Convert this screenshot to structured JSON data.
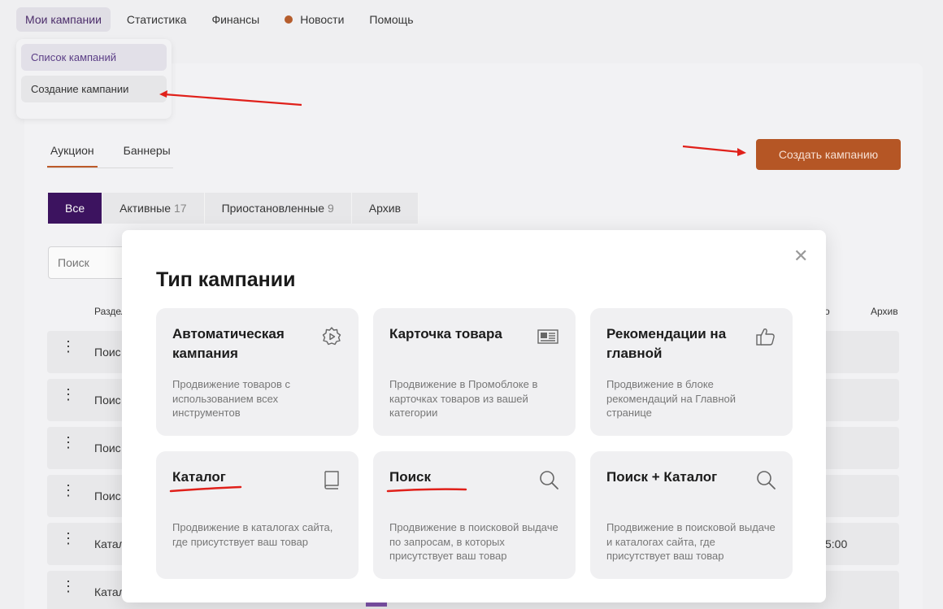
{
  "topnav": {
    "items": [
      {
        "label": "Мои кампании"
      },
      {
        "label": "Статистика"
      },
      {
        "label": "Финансы"
      },
      {
        "label": "Новости"
      },
      {
        "label": "Помощь"
      }
    ]
  },
  "dropdown": {
    "items": [
      {
        "label": "Список кампаний"
      },
      {
        "label": "Создание кампании"
      }
    ]
  },
  "tabs": [
    {
      "label": "Аукцион"
    },
    {
      "label": "Баннеры"
    }
  ],
  "create_button": "Создать кампанию",
  "filters": [
    {
      "label": "Все",
      "count": ""
    },
    {
      "label": "Активные",
      "count": "17"
    },
    {
      "label": "Приостановленные",
      "count": "9"
    },
    {
      "label": "Архив",
      "count": ""
    }
  ],
  "search": {
    "placeholder": "Поиск"
  },
  "columns": {
    "section": "Раздел",
    "archive": "Архив",
    "end": "о"
  },
  "rows": [
    {
      "name": "Поис",
      "time": ""
    },
    {
      "name": "Поис",
      "time": ""
    },
    {
      "name": "Поис",
      "time": ""
    },
    {
      "name": "Поис",
      "time": ""
    },
    {
      "name": "Катал",
      "time": "5:00"
    },
    {
      "name": "Катал",
      "time": ""
    }
  ],
  "modal": {
    "title": "Тип кампании",
    "cards": [
      {
        "title": "Автоматическая кампания",
        "desc": "Продвижение товаров с использованием всех инструментов",
        "icon": "gear-play-icon"
      },
      {
        "title": "Карточка товара",
        "desc": "Продвижение в Промоблоке в карточках товаров из вашей категории",
        "icon": "product-card-icon"
      },
      {
        "title": "Рекомендации на главной",
        "desc": "Продвижение в блоке рекомендаций на Главной странице",
        "icon": "thumbs-up-icon"
      },
      {
        "title": "Каталог",
        "desc": "Продвижение в каталогах сайта, где присутствует ваш товар",
        "icon": "book-icon"
      },
      {
        "title": "Поиск",
        "desc": "Продвижение в поисковой выдаче по запросам, в которых присутствует ваш товар",
        "icon": "search-icon"
      },
      {
        "title": "Поиск + Каталог",
        "desc": "Продвижение в поисковой выдаче и каталогах сайта, где присутствует ваш товар",
        "icon": "search-icon"
      }
    ]
  },
  "colors": {
    "accent": "#b85522",
    "active_filter": "#3a0f5e",
    "annotation": "#e0201a"
  }
}
